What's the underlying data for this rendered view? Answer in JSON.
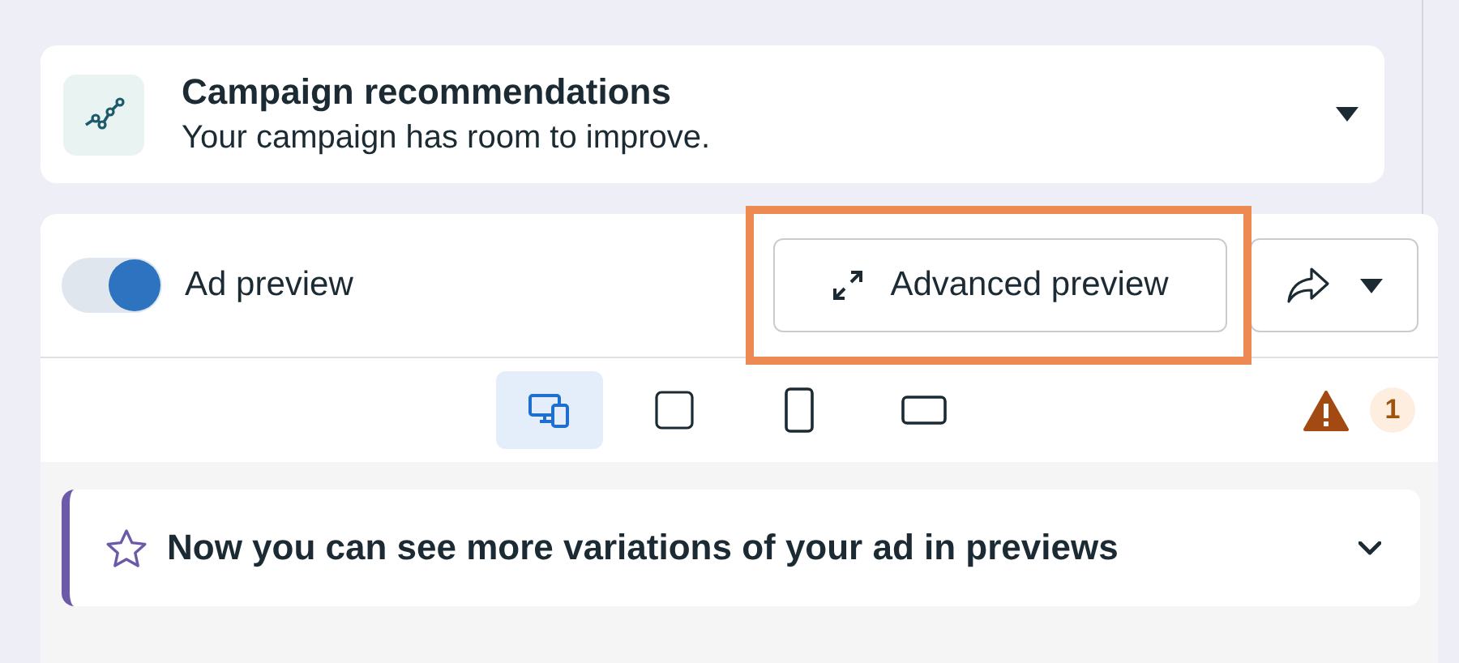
{
  "recommendations": {
    "title": "Campaign recommendations",
    "subtitle": "Your campaign has room to improve.",
    "expanded": false
  },
  "ad_preview": {
    "label": "Ad preview",
    "on": true,
    "advanced_button": "Advanced preview",
    "highlighted": true
  },
  "devices": [
    {
      "kind": "desktop-mobile",
      "selected": true
    },
    {
      "kind": "square",
      "selected": false
    },
    {
      "kind": "portrait",
      "selected": false
    },
    {
      "kind": "landscape",
      "selected": false
    }
  ],
  "warnings": {
    "count": "1"
  },
  "notice": {
    "text": "Now you can see more variations of your ad in previews",
    "expanded": false
  }
}
